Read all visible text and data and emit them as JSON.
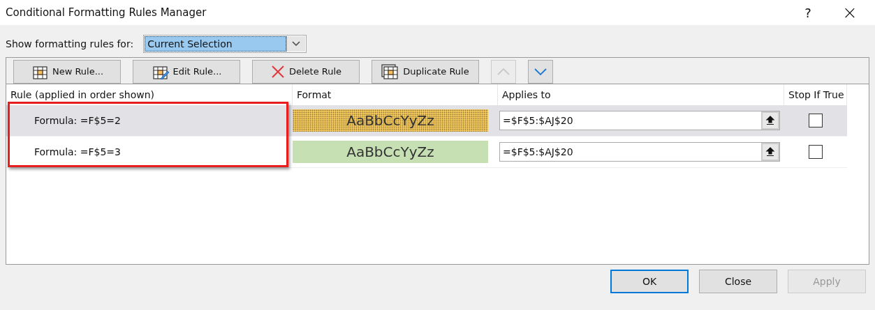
{
  "window": {
    "title": "Conditional Formatting Rules Manager",
    "help": "?",
    "close": "×"
  },
  "show_rules_for": {
    "label": "Show formatting rules for:",
    "value": "Current Selection"
  },
  "toolbar": [
    {
      "label": "New Rule...",
      "kind": "new"
    },
    {
      "label": "Edit Rule...",
      "kind": "edit"
    },
    {
      "label": "Delete Rule",
      "kind": "delete"
    },
    {
      "label": "Duplicate Rule",
      "kind": "duplicate"
    },
    {
      "kind": "up",
      "disabled": true
    },
    {
      "kind": "down",
      "disabled": false
    }
  ],
  "table": {
    "columns": [
      "Rule (applied in order shown)",
      "Format",
      "Applies to",
      "Stop If True"
    ],
    "rows": [
      {
        "rule": "Formula: =F$5=2",
        "preview": "AaBbCcYyZz",
        "color": "#f2c75c",
        "dotted": true,
        "applies_to": "=$F$5:$AJ$20",
        "stop_if_true": false,
        "selected": true
      },
      {
        "rule": "Formula: =F$5=3",
        "preview": "AaBbCcYyZz",
        "color": "#c6e0b4",
        "dotted": false,
        "applies_to": "=$F$5:$AJ$20",
        "stop_if_true": false,
        "selected": false
      }
    ]
  },
  "buttons": [
    {
      "label": "OK",
      "default": true,
      "disabled": false
    },
    {
      "label": "Close",
      "default": false,
      "disabled": false
    },
    {
      "label": "Apply",
      "default": false,
      "disabled": true
    }
  ]
}
